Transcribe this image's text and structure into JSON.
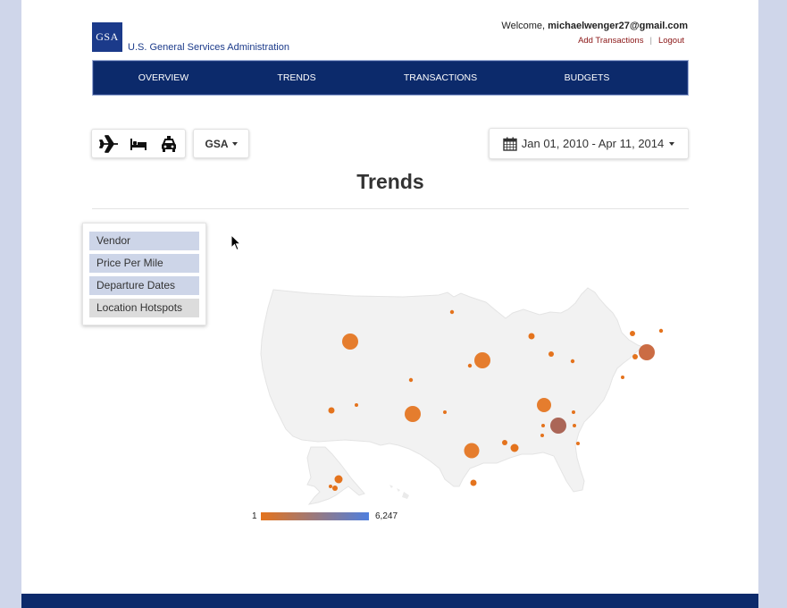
{
  "header": {
    "logo_text": "GSA",
    "agency_name": "U.S. General Services Administration",
    "welcome_prefix": "Welcome, ",
    "user_email": "michaelwenger27@gmail.com",
    "add_transactions": "Add Transactions",
    "separator": "|",
    "logout": "Logout"
  },
  "nav": {
    "items": [
      "OVERVIEW",
      "TRENDS",
      "TRANSACTIONS",
      "BUDGETS"
    ]
  },
  "toolbar": {
    "travel_icons": [
      "airplane-icon",
      "bed-icon",
      "car-icon"
    ],
    "agency_select": "GSA",
    "date_range": "Jan 01, 2010 - Apr 11, 2014"
  },
  "page": {
    "title": "Trends"
  },
  "side_menu": {
    "items": [
      "Vendor",
      "Price Per Mile",
      "Departure Dates",
      "Location Hotspots"
    ],
    "active": "Location Hotspots"
  },
  "map_legend": {
    "min_label": "1",
    "max_label": "6,247",
    "min_color": "#e4731d",
    "max_color": "#4f7fde"
  },
  "colors": {
    "nav_bg": "#0c2a6b",
    "menu_item_bg": "#cdd5e8",
    "bubble": "#e4731d"
  }
}
